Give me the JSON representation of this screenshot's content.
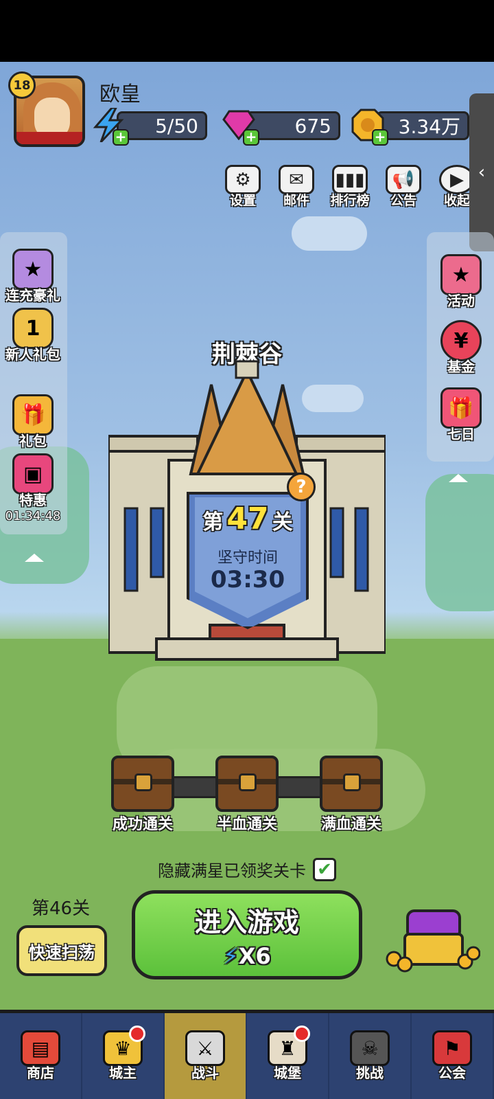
{
  "player": {
    "level": "18",
    "name": "欧皇"
  },
  "resources": {
    "energy": "5/50",
    "gems": "675",
    "gold": "3.34万"
  },
  "top_menu": [
    {
      "label": "设置",
      "icon": "gear-icon"
    },
    {
      "label": "邮件",
      "icon": "mail-icon"
    },
    {
      "label": "排行榜",
      "icon": "leaderboard-icon"
    },
    {
      "label": "公告",
      "icon": "megaphone-icon"
    },
    {
      "label": "收起",
      "icon": "collapse-icon"
    }
  ],
  "left_side": [
    {
      "label": "连充豪礼",
      "icon": "gift-box-icon"
    },
    {
      "label": "新人礼包",
      "icon": "badge-1-icon",
      "badge": "1"
    },
    {
      "label": "礼包",
      "icon": "gift-icon"
    },
    {
      "label": "特惠",
      "icon": "chest-icon",
      "timer": "01:34:48"
    }
  ],
  "right_side": [
    {
      "label": "活动",
      "icon": "stars-gift-icon"
    },
    {
      "label": "基金",
      "icon": "money-bag-icon"
    },
    {
      "label": "七日",
      "icon": "gift-ribbon-icon"
    }
  ],
  "stage": {
    "name": "荆棘谷",
    "prefix": "第",
    "number": "47",
    "suffix": "关",
    "hold_label": "坚守时间",
    "hold_time": "03:30"
  },
  "chests": [
    "成功通关",
    "半血通关",
    "满血通关"
  ],
  "hide_option": {
    "label": "隐藏满星已领奖关卡",
    "checked": true
  },
  "prev_stage": "第46关",
  "sweep_label": "快速扫荡",
  "enter": {
    "label": "进入游戏",
    "cost": "X6"
  },
  "nav": [
    {
      "label": "商店",
      "icon": "shop-icon",
      "dot": false
    },
    {
      "label": "城主",
      "icon": "crown-icon",
      "dot": true
    },
    {
      "label": "战斗",
      "icon": "crossed-swords-icon",
      "dot": false,
      "active": true
    },
    {
      "label": "城堡",
      "icon": "castle-icon",
      "dot": true
    },
    {
      "label": "挑战",
      "icon": "monster-icon",
      "dot": false
    },
    {
      "label": "公会",
      "icon": "guild-banner-icon",
      "dot": false
    }
  ],
  "colors": {
    "accent_green": "#5cc13b",
    "nav_bg": "#2d4271",
    "active_tab": "#b59a3e",
    "stage_number": "#ffe23b"
  }
}
